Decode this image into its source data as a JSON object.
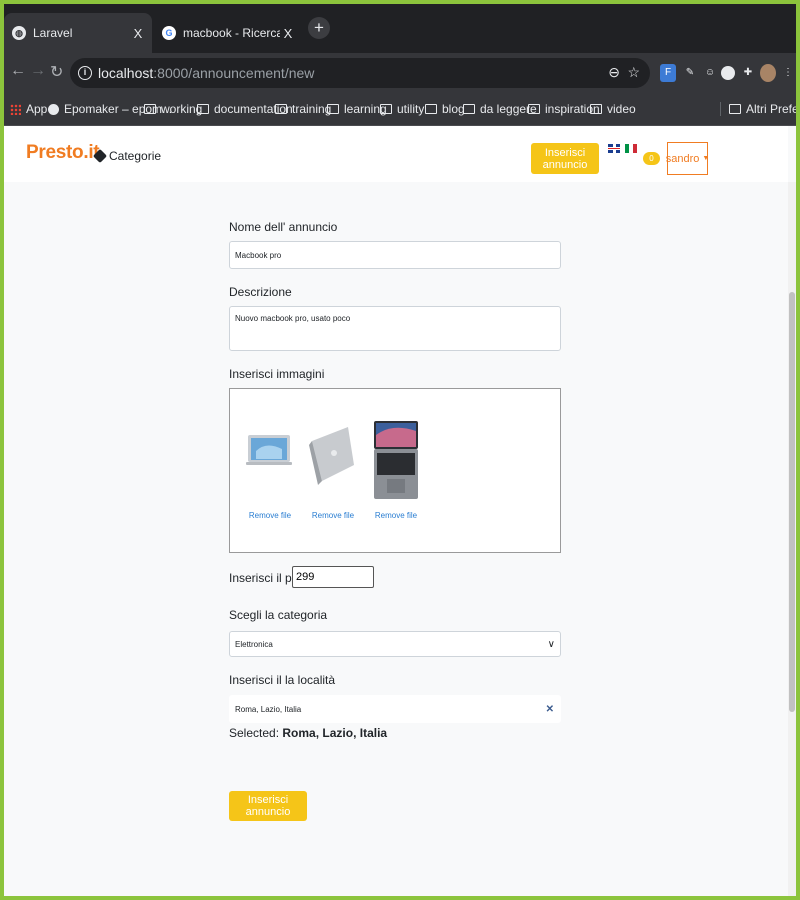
{
  "browser": {
    "tabs": [
      {
        "title": "Laravel",
        "active": true,
        "icon": "globe-icon"
      },
      {
        "title": "macbook - Ricerca Google",
        "active": false,
        "icon": "google-icon"
      }
    ],
    "close_glyph": "X",
    "new_tab_glyph": "+",
    "url_host": "localhost",
    "url_rest": ":8000/announcement/new",
    "bookmarks": [
      {
        "label": "App",
        "icon": "apps-grid-icon"
      },
      {
        "label": "Epomaker – epom...",
        "icon": "globe-icon"
      },
      {
        "label": "working",
        "icon": "folder-icon"
      },
      {
        "label": "documentation",
        "icon": "folder-icon"
      },
      {
        "label": "training",
        "icon": "folder-icon"
      },
      {
        "label": "learning",
        "icon": "folder-icon"
      },
      {
        "label": "utility",
        "icon": "folder-icon"
      },
      {
        "label": "blog",
        "icon": "folder-icon"
      },
      {
        "label": "da leggere",
        "icon": "folder-icon"
      },
      {
        "label": "inspiration",
        "icon": "folder-icon"
      },
      {
        "label": "video",
        "icon": "folder-icon"
      }
    ],
    "other_bookmarks": "Altri Preferiti"
  },
  "navbar": {
    "brand": "Presto.it",
    "categories_label": "Categorie",
    "insert_button": "Inserisci annuncio",
    "badge_count": "0",
    "user_name": "sandro"
  },
  "form": {
    "name_label": "Nome dell' annuncio",
    "name_value": "Macbook pro",
    "description_label": "Descrizione",
    "description_value": "Nuovo macbook pro, usato poco",
    "images_label": "Inserisci immagini",
    "images": [
      {
        "remove_label": "Remove file"
      },
      {
        "remove_label": "Remove file"
      },
      {
        "remove_label": "Remove file"
      }
    ],
    "price_label": "Inserisci il prezzo",
    "price_value": "299",
    "category_label": "Scegli la categoria",
    "category_value": "Elettronica",
    "location_label": "Inserisci il la località",
    "location_value": "Roma, Lazio, Italia",
    "selected_prefix": "Selected:",
    "selected_value": "Roma, Lazio, Italia",
    "submit_label": "Inserisci annuncio"
  },
  "colors": {
    "brand": "#f07c22",
    "accent_yellow": "#f5c518",
    "link_blue": "#2a7ed2",
    "frame_green": "#8cc43c"
  }
}
